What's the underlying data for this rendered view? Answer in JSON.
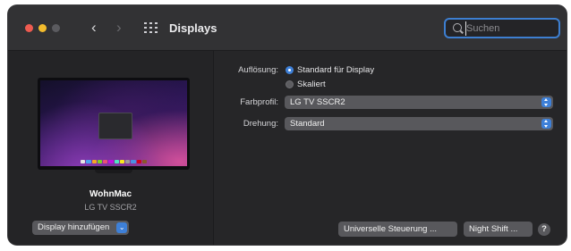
{
  "window": {
    "title": "Displays"
  },
  "search": {
    "placeholder": "Suchen",
    "value": ""
  },
  "sidebar": {
    "display_name": "WohnMac",
    "display_model": "LG TV SSCR2",
    "add_display_label": "Display hinzufügen"
  },
  "settings": {
    "resolution": {
      "label": "Auflösung:",
      "options": [
        "Standard für Display",
        "Skaliert"
      ],
      "selected": "Standard für Display"
    },
    "color_profile": {
      "label": "Farbprofil:",
      "value": "LG TV SSCR2"
    },
    "rotation": {
      "label": "Drehung:",
      "value": "Standard"
    }
  },
  "footer": {
    "universal_control_label": "Universelle Steuerung ...",
    "night_shift_label": "Night Shift ...",
    "help_label": "?"
  },
  "colors": {
    "accent": "#3e80d8",
    "window_bg": "#262628",
    "control_bg": "#58585c"
  }
}
